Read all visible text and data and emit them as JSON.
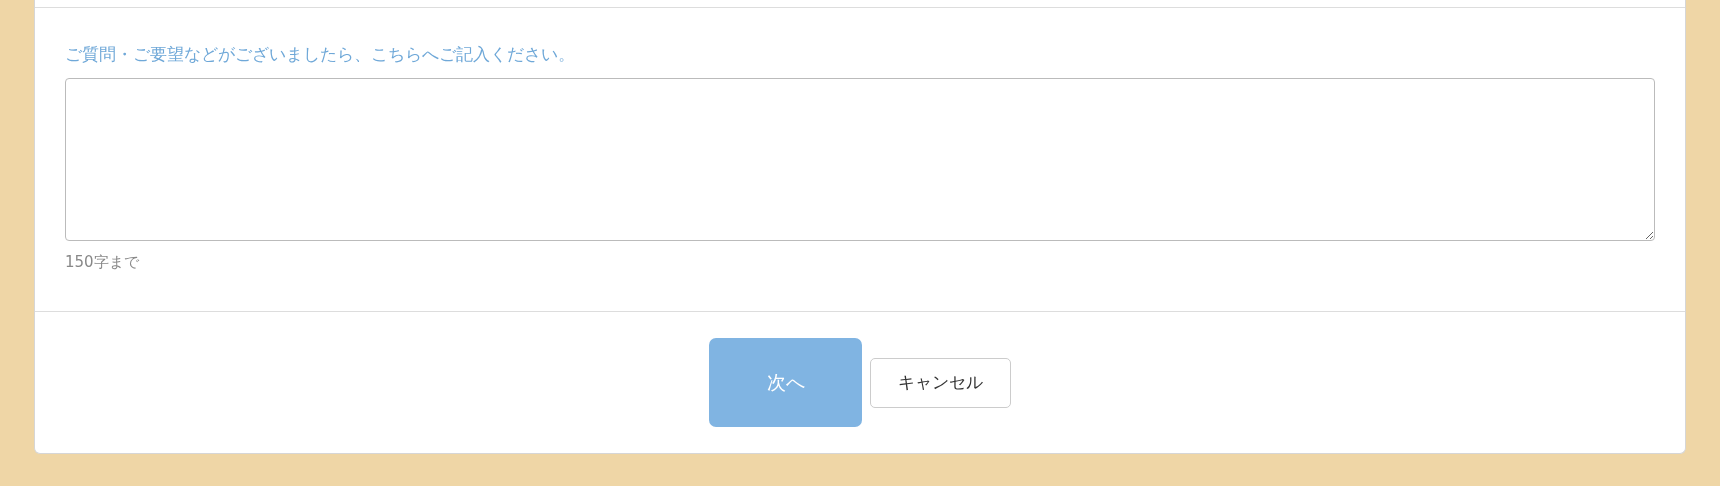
{
  "form": {
    "label": "ご質問・ご要望などがございましたら、こちらへご記入ください。",
    "hint": "150字まで"
  },
  "buttons": [
    {
      "kind": "primary",
      "label": "次へ",
      "disabled": true
    },
    {
      "kind": "secondary",
      "label": "キャンセル",
      "disabled": false
    }
  ]
}
